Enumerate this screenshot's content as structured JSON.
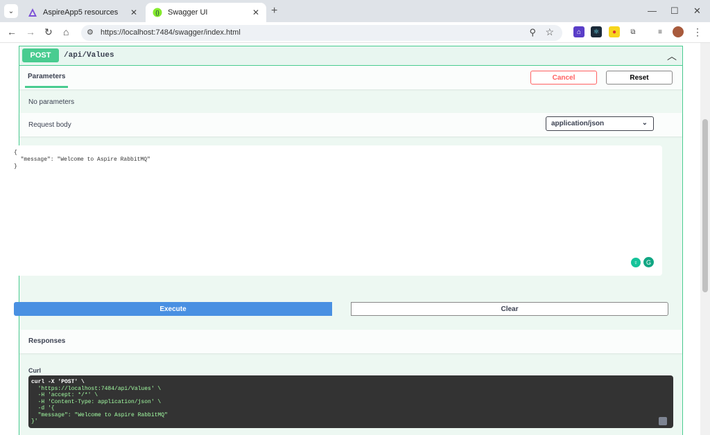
{
  "browser": {
    "tabs": [
      {
        "label": "AspireApp5 resources",
        "active": false
      },
      {
        "label": "Swagger UI",
        "active": true
      }
    ],
    "url": "https://localhost:7484/swagger/index.html",
    "icons": [
      "back-icon",
      "forward-icon",
      "reload-icon",
      "home-icon",
      "site-settings-icon",
      "zoom-icon",
      "bookmark-star-icon",
      "extension-icon",
      "profile-avatar"
    ]
  },
  "operation": {
    "method": "POST",
    "path": "/api/Values",
    "method_color": "#49cc90"
  },
  "parameters": {
    "tab_label": "Parameters",
    "cancel_label": "Cancel",
    "reset_label": "Reset",
    "no_params_text": "No parameters"
  },
  "request_body": {
    "label": "Request body",
    "content_type": "application/json",
    "value": "{\n  \"message\": \"Welcome to Aspire RabbitMQ\"\n}"
  },
  "actions": {
    "execute_label": "Execute",
    "clear_label": "Clear"
  },
  "responses": {
    "label": "Responses",
    "curl_label": "Curl",
    "curl_lines": [
      "curl -X 'POST' \\",
      "  'https://localhost:7484/api/Values' \\",
      "  -H 'accept: */*' \\",
      "  -H 'Content-Type: application/json' \\",
      "  -d '{",
      "  \"message\": \"Welcome to Aspire RabbitMQ\"",
      "}'"
    ]
  }
}
